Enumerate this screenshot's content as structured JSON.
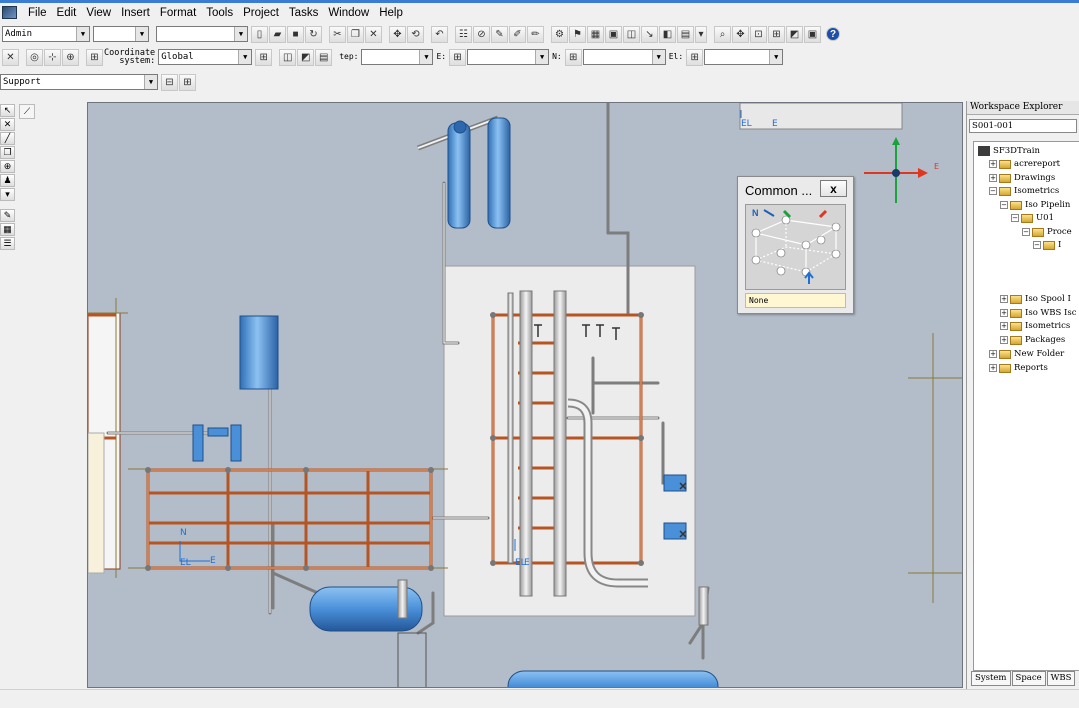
{
  "menu": [
    "File",
    "Edit",
    "View",
    "Insert",
    "Format",
    "Tools",
    "Project",
    "Tasks",
    "Window",
    "Help"
  ],
  "toolbar1": {
    "permission_group": "Admin",
    "filter_value": "",
    "style_value": ""
  },
  "toolbar2": {
    "coordinate_label_1": "Coordinate",
    "coordinate_label_2": "system:",
    "coordinate_value": "Global",
    "step_label": "tep:",
    "step_value": "",
    "e_label": "E:",
    "e_value": "",
    "n_label": "N:",
    "n_value": "",
    "el_label": "El:",
    "el_value": ""
  },
  "toolbar3": {
    "task_value": "Support"
  },
  "common_panel": {
    "title": "Common ...",
    "close": "x",
    "axis_label": "N",
    "status": "None"
  },
  "explorer": {
    "title": "Workspace Explorer",
    "filter": "S001-001",
    "tree": [
      {
        "label": "SF3DTrain",
        "level": 0
      },
      {
        "label": "acrereport",
        "level": 1
      },
      {
        "label": "Drawings",
        "level": 1
      },
      {
        "label": "Isometrics",
        "level": 1
      },
      {
        "label": "Iso Pipelin",
        "level": 2
      },
      {
        "label": "U01",
        "level": 3
      },
      {
        "label": "Proce",
        "level": 4
      },
      {
        "label": "I",
        "level": 5
      },
      {
        "label": "Iso Spool I",
        "level": 2
      },
      {
        "label": "Iso WBS Isc",
        "level": 2
      },
      {
        "label": "Isometrics",
        "level": 2
      },
      {
        "label": "Packages",
        "level": 2
      },
      {
        "label": "New Folder",
        "level": 1
      },
      {
        "label": "Reports",
        "level": 1
      }
    ],
    "tabs": [
      "System",
      "Space",
      "WBS"
    ]
  },
  "viewport": {
    "compass_label": "E",
    "marker_n": "N",
    "marker_el": "EL",
    "marker_e": "E"
  },
  "colors": {
    "viewport_bg": "#b3bdc9",
    "structure": "#c05a26",
    "vessel": "#4a90d9"
  }
}
